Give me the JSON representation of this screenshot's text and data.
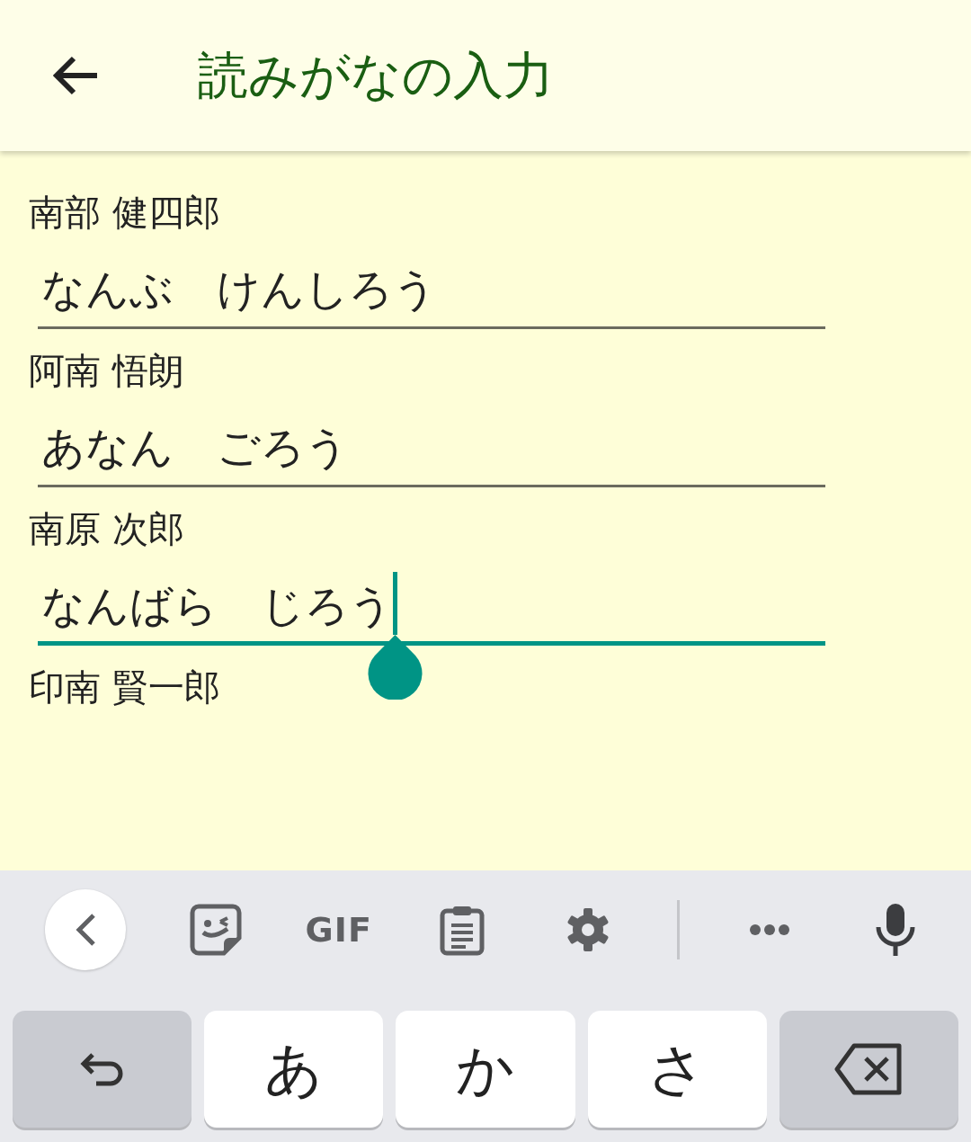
{
  "app_bar": {
    "title": "読みがなの入力"
  },
  "entries": [
    {
      "name": "南部 健四郎",
      "reading": "なんぶ　けんしろう",
      "focused": false
    },
    {
      "name": "阿南 悟朗",
      "reading": "あなん　ごろう",
      "focused": false
    },
    {
      "name": "南原 次郎",
      "reading": "なんばら　じろう",
      "focused": true
    },
    {
      "name": "印南 賢一郎"
    }
  ],
  "keyboard": {
    "toolbar": [
      {
        "kind": "collapse"
      },
      {
        "kind": "sticker"
      },
      {
        "kind": "text",
        "label": "GIF"
      },
      {
        "kind": "clipboard"
      },
      {
        "kind": "settings"
      },
      {
        "kind": "divider"
      },
      {
        "kind": "more"
      },
      {
        "kind": "mic"
      }
    ],
    "keys": [
      {
        "kind": "undo"
      },
      {
        "kind": "char",
        "label": "あ"
      },
      {
        "kind": "char",
        "label": "か"
      },
      {
        "kind": "char",
        "label": "さ"
      },
      {
        "kind": "backspace"
      }
    ]
  }
}
